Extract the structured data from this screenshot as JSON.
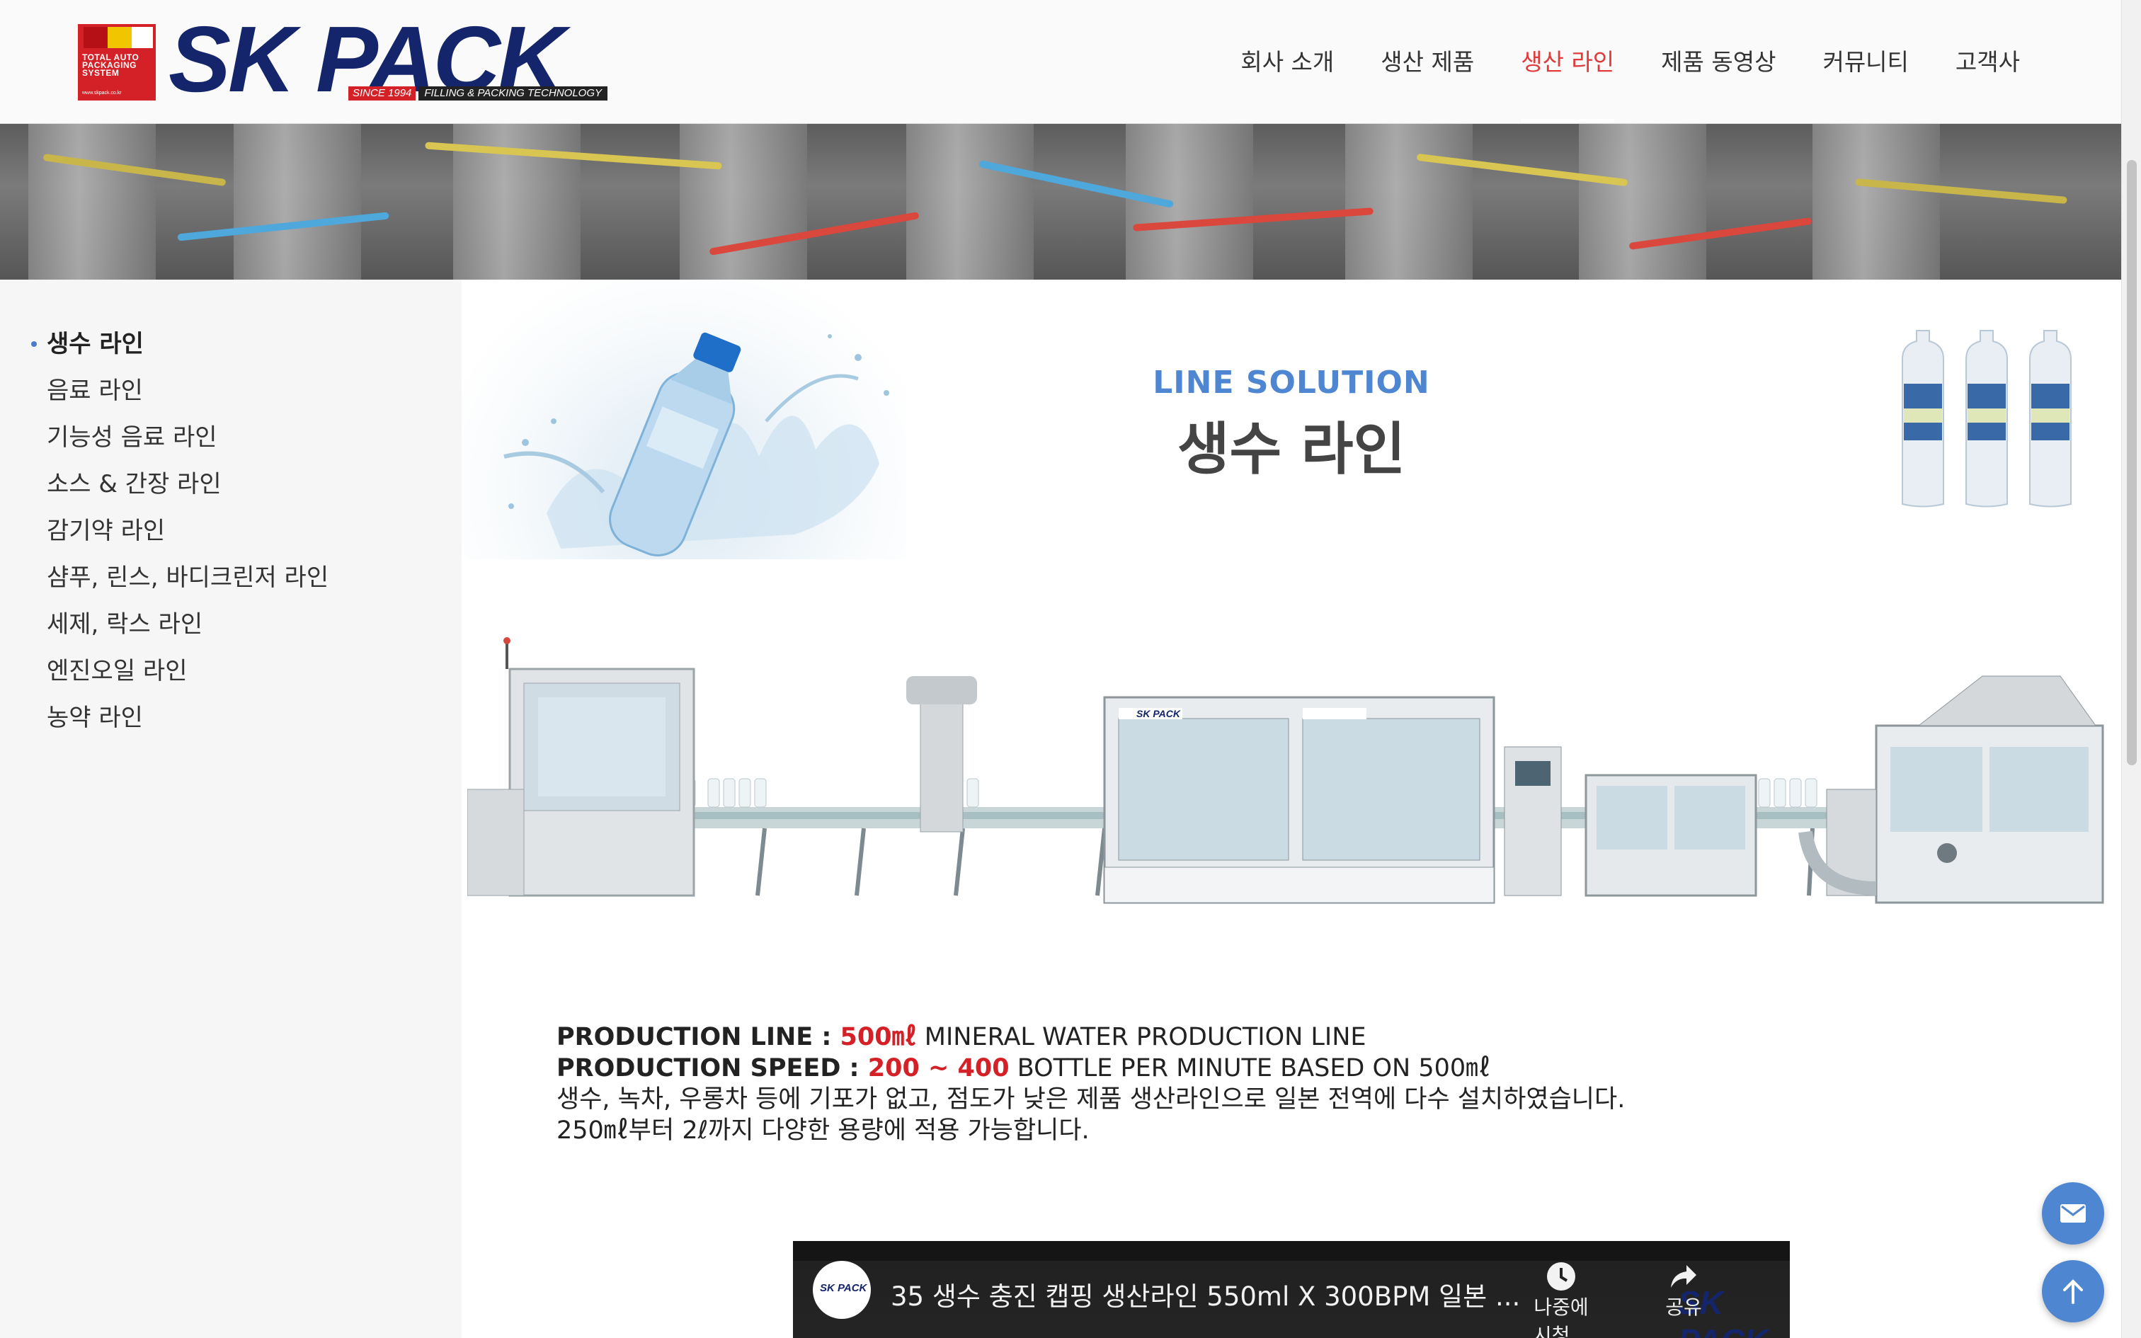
{
  "brand": {
    "badge_text": "TOTAL AUTO PACKAGING SYSTEM",
    "badge_url": "www.skpack.co.kr",
    "name": "SK PACK",
    "since": "SINCE 1994",
    "tagline": "FILLING & PACKING TECHNOLOGY"
  },
  "nav": {
    "items": [
      {
        "label": "회사 소개"
      },
      {
        "label": "생산 제품"
      },
      {
        "label": "생산 라인"
      },
      {
        "label": "제품 동영상"
      },
      {
        "label": "커뮤니티"
      },
      {
        "label": "고객사"
      }
    ],
    "active": "생산 라인"
  },
  "sidebar": {
    "items": [
      {
        "label": "생수 라인"
      },
      {
        "label": "음료 라인"
      },
      {
        "label": "기능성 음료 라인"
      },
      {
        "label": "소스 & 간장 라인"
      },
      {
        "label": "감기약 라인"
      },
      {
        "label": "샴푸, 린스, 바디크린저 라인"
      },
      {
        "label": "세제, 락스 라인"
      },
      {
        "label": "엔진오일 라인"
      },
      {
        "label": "농약 라인"
      }
    ],
    "active": "생수 라인"
  },
  "main": {
    "eyebrow": "LINE SOLUTION",
    "title": "생수 라인",
    "machine_brand": "SK PACK",
    "specs": {
      "line_label": "PRODUCTION LINE",
      "line_value": "500㎖",
      "line_desc": "MINERAL WATER PRODUCTION LINE",
      "speed_label": "PRODUCTION SPEED",
      "speed_value": "200 ~ 400",
      "speed_desc": "BOTTLE PER MINUTE BASED ON 500㎖",
      "desc1": "생수, 녹차, 우롱차 등에 기포가 없고, 점도가 낮은 제품 생산라인으로 일본 전역에 다수 설치하였습니다.",
      "desc2": "250㎖부터 2ℓ까지 다양한 용량에 적용 가능합니다."
    },
    "video": {
      "title": "35 생수 충진 캡핑 생산라인 550ml X 300BPM 일본 ...",
      "watch_later": "나중에 시청...",
      "share": "공유",
      "channel": "SK PACK"
    }
  },
  "colors": {
    "accent_blue": "#4f86d2",
    "nav_active": "#e03a3a",
    "brand_navy": "#14256b",
    "brand_red": "#d42127"
  },
  "icons": {
    "mail_button": "mail-icon",
    "top_button": "arrow-up-icon",
    "watch_later": "clock-icon",
    "share": "share-icon"
  }
}
